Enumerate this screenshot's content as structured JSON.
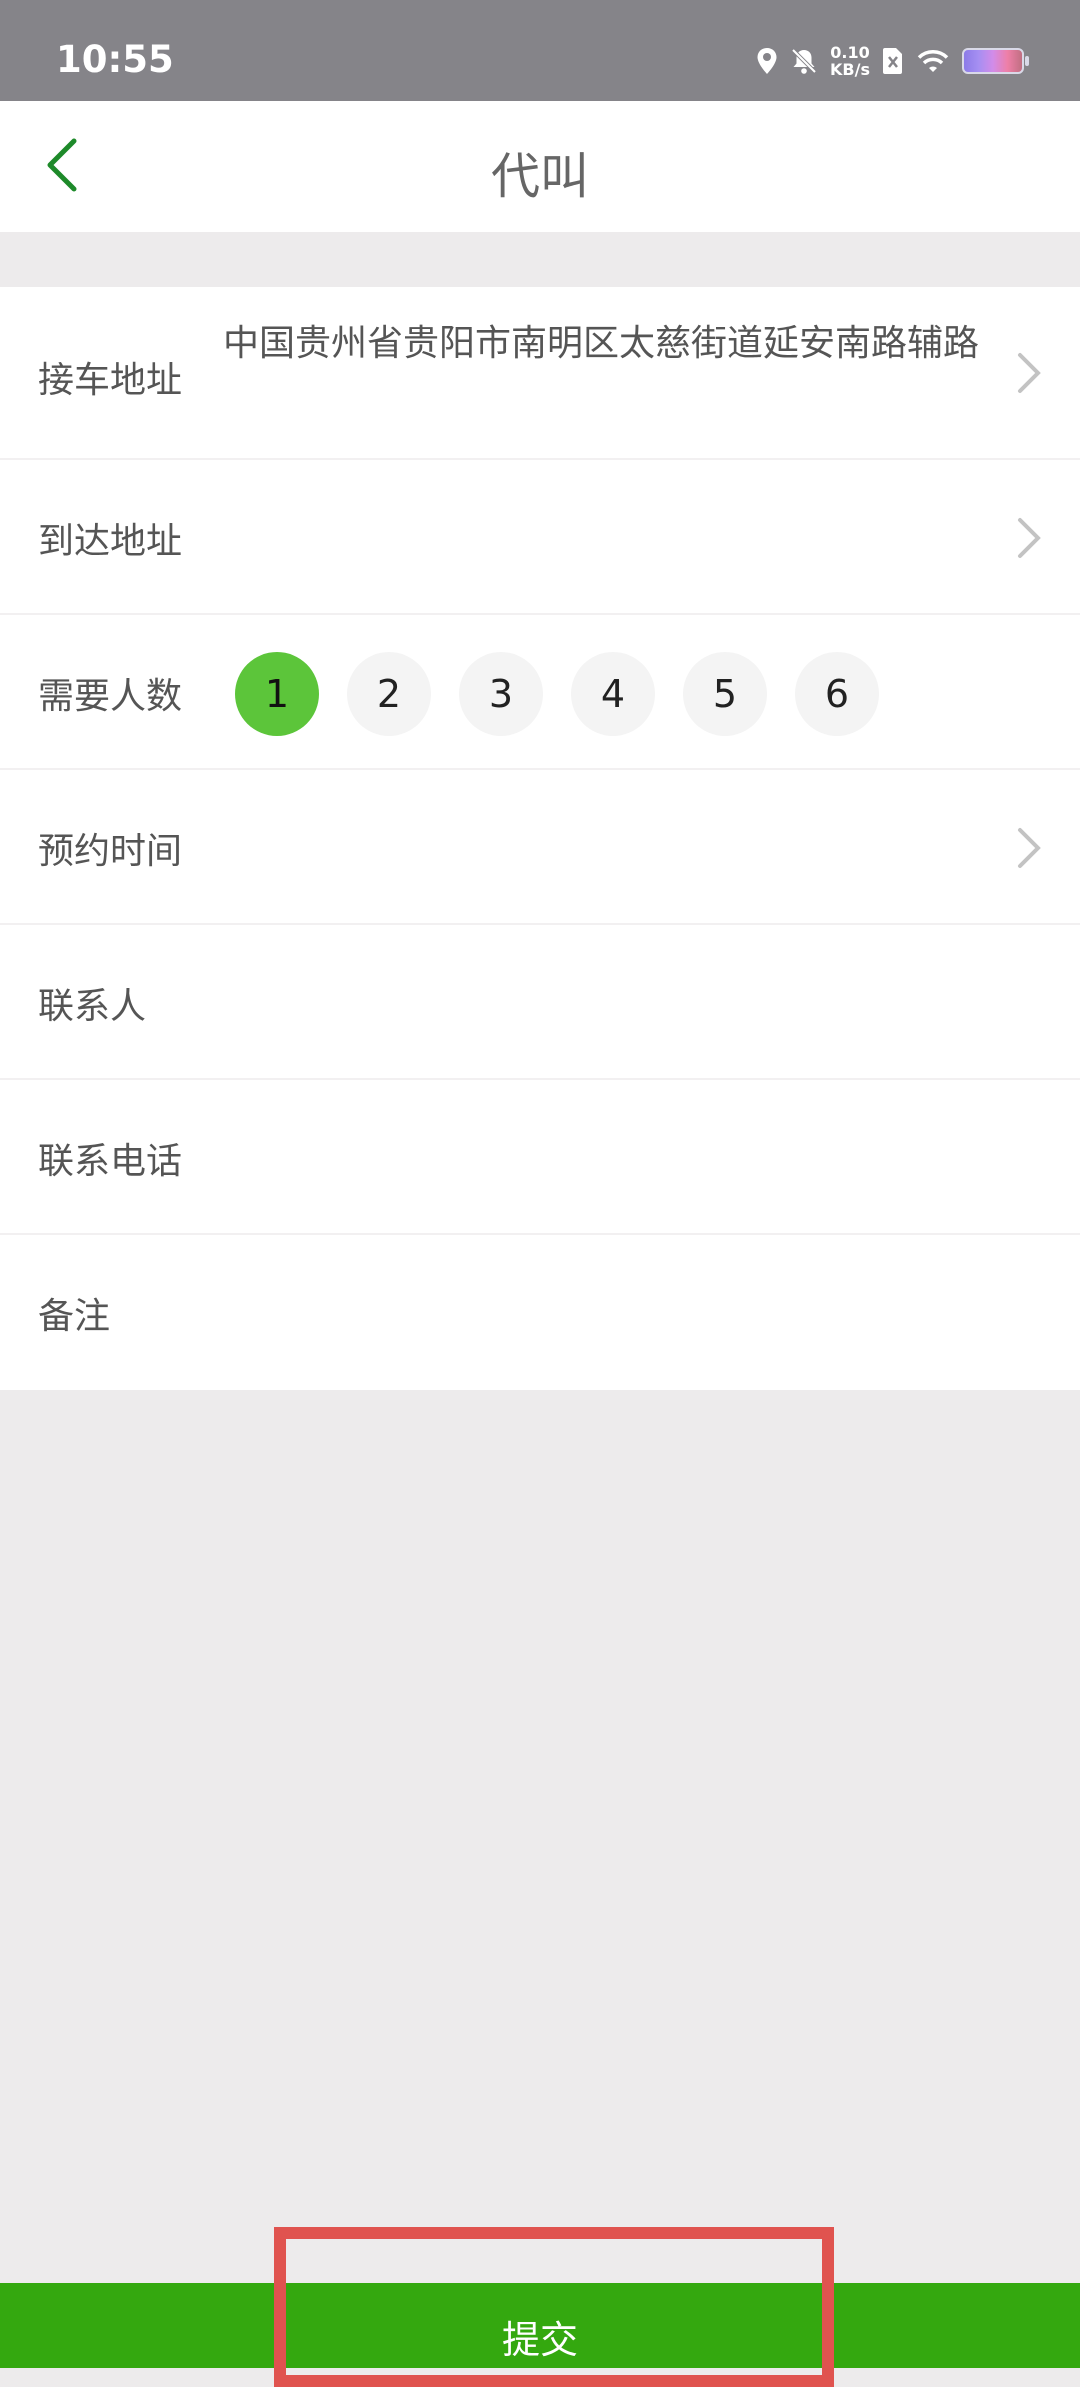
{
  "status_bar": {
    "time": "10:55",
    "net_speed_value": "0.10",
    "net_speed_unit": "KB/s",
    "icons": [
      "location-icon",
      "mute-icon",
      "sim-icon",
      "wifi-icon",
      "battery-icon"
    ]
  },
  "header": {
    "title": "代叫",
    "back_icon": "chevron-left-icon"
  },
  "form": {
    "pickup": {
      "label": "接车地址",
      "value": "中国贵州省贵阳市南明区太慈街道延安南路辅路"
    },
    "destination": {
      "label": "到达地址",
      "value": ""
    },
    "passenger_count": {
      "label": "需要人数",
      "options": [
        "1",
        "2",
        "3",
        "4",
        "5",
        "6"
      ],
      "selected": "1"
    },
    "reservation_time": {
      "label": "预约时间",
      "value": ""
    },
    "contact_name": {
      "label": "联系人",
      "value": ""
    },
    "contact_phone": {
      "label": "联系电话",
      "value": ""
    },
    "remark": {
      "label": "备注",
      "value": ""
    }
  },
  "submit_label": "提交",
  "colors": {
    "accent": "#34a80f",
    "selected": "#5cc53a",
    "highlight": "#e0534f",
    "back_icon": "#1e8a2a"
  }
}
